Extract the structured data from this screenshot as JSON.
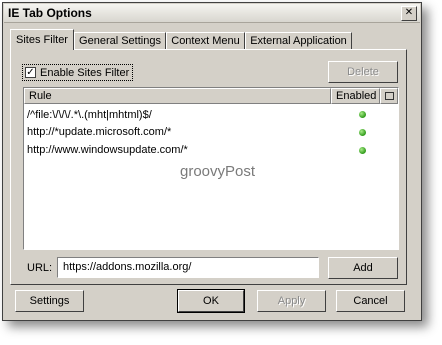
{
  "window": {
    "title": "IE Tab Options",
    "close_glyph": "✕"
  },
  "tabs": [
    {
      "label": "Sites Filter",
      "active": true
    },
    {
      "label": "General Settings",
      "active": false
    },
    {
      "label": "Context Menu",
      "active": false
    },
    {
      "label": "External Application",
      "active": false
    }
  ],
  "filter": {
    "checkbox_label": "Enable Sites Filter",
    "checked": true,
    "check_glyph": "✓"
  },
  "buttons": {
    "delete": "Delete",
    "add": "Add",
    "settings": "Settings",
    "ok": "OK",
    "apply": "Apply",
    "cancel": "Cancel"
  },
  "list": {
    "columns": [
      "Rule",
      "Enabled"
    ],
    "column_icon": "grid-icon",
    "rows": [
      {
        "rule": "/^file:\\/\\/\\/.*\\.(mht|mhtml)$/",
        "enabled": true
      },
      {
        "rule": "http://*update.microsoft.com/*",
        "enabled": true
      },
      {
        "rule": "http://www.windowsupdate.com/*",
        "enabled": true
      }
    ]
  },
  "watermark": "groovyPost",
  "url": {
    "label": "URL:",
    "value": "https://addons.mozilla.org/"
  }
}
